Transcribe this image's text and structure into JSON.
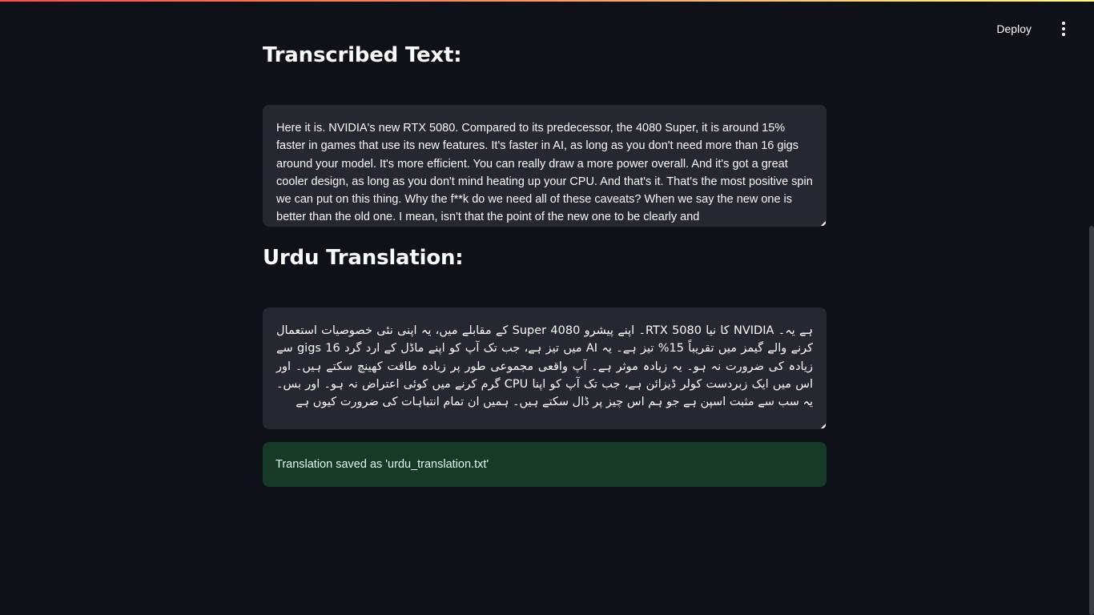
{
  "header": {
    "deploy_label": "Deploy",
    "menu_icon": "more-vertical-icon"
  },
  "transcribed": {
    "title": "Transcribed Text:",
    "text": " Here it is. NVIDIA's new RTX 5080. Compared to its predecessor, the 4080 Super, it is around 15% faster in games that use its new features. It's faster in AI, as long as you don't need more than 16 gigs around your model. It's more efficient. You can really draw a more power overall. And it's got a great cooler design, as long as you don't mind heating up your CPU. And that's it. That's the most positive spin we can put on this thing. Why the f**k do we need all of these caveats? When we say the new one is better than the old one. I mean, isn't that the point of the new one to be clearly and"
  },
  "urdu": {
    "title": "Urdu Translation:",
    "text": "ہے یہ۔ NVIDIA کا نیا RTX 5080۔ اپنے پیشرو 4080 Super کے مقابلے میں، یہ اپنی نئی خصوصیات استعمال کرنے والے گیمز میں تقریباً 15% تیز ہے۔ یہ AI میں تیز ہے، جب تک آپ کو اپنے ماڈل کے ارد گرد 16 gigs سے زیادہ کی ضرورت نہ ہو۔ یہ زیادہ موثر ہے۔ آپ واقعی مجموعی طور پر زیادہ طاقت کھینچ سکتے ہیں۔ اور اس میں ایک زبردست کولر ڈیزائن ہے، جب تک آپ کو اپنا CPU گرم کرنے میں کوئی اعتراض نہ ہو۔ اور بس۔ یہ سب سے مثبت اسپن ہے جو ہم اس چیز پر ڈال سکتے ہیں۔ ہمیں ان تمام انتباہات کی ضرورت کیوں ہے"
  },
  "alert": {
    "text": "Translation saved as 'urdu_translation.txt'"
  },
  "colors": {
    "background": "#0e1117",
    "textarea": "#262730",
    "success_bg": "#173928",
    "success_text": "#dffde9"
  }
}
